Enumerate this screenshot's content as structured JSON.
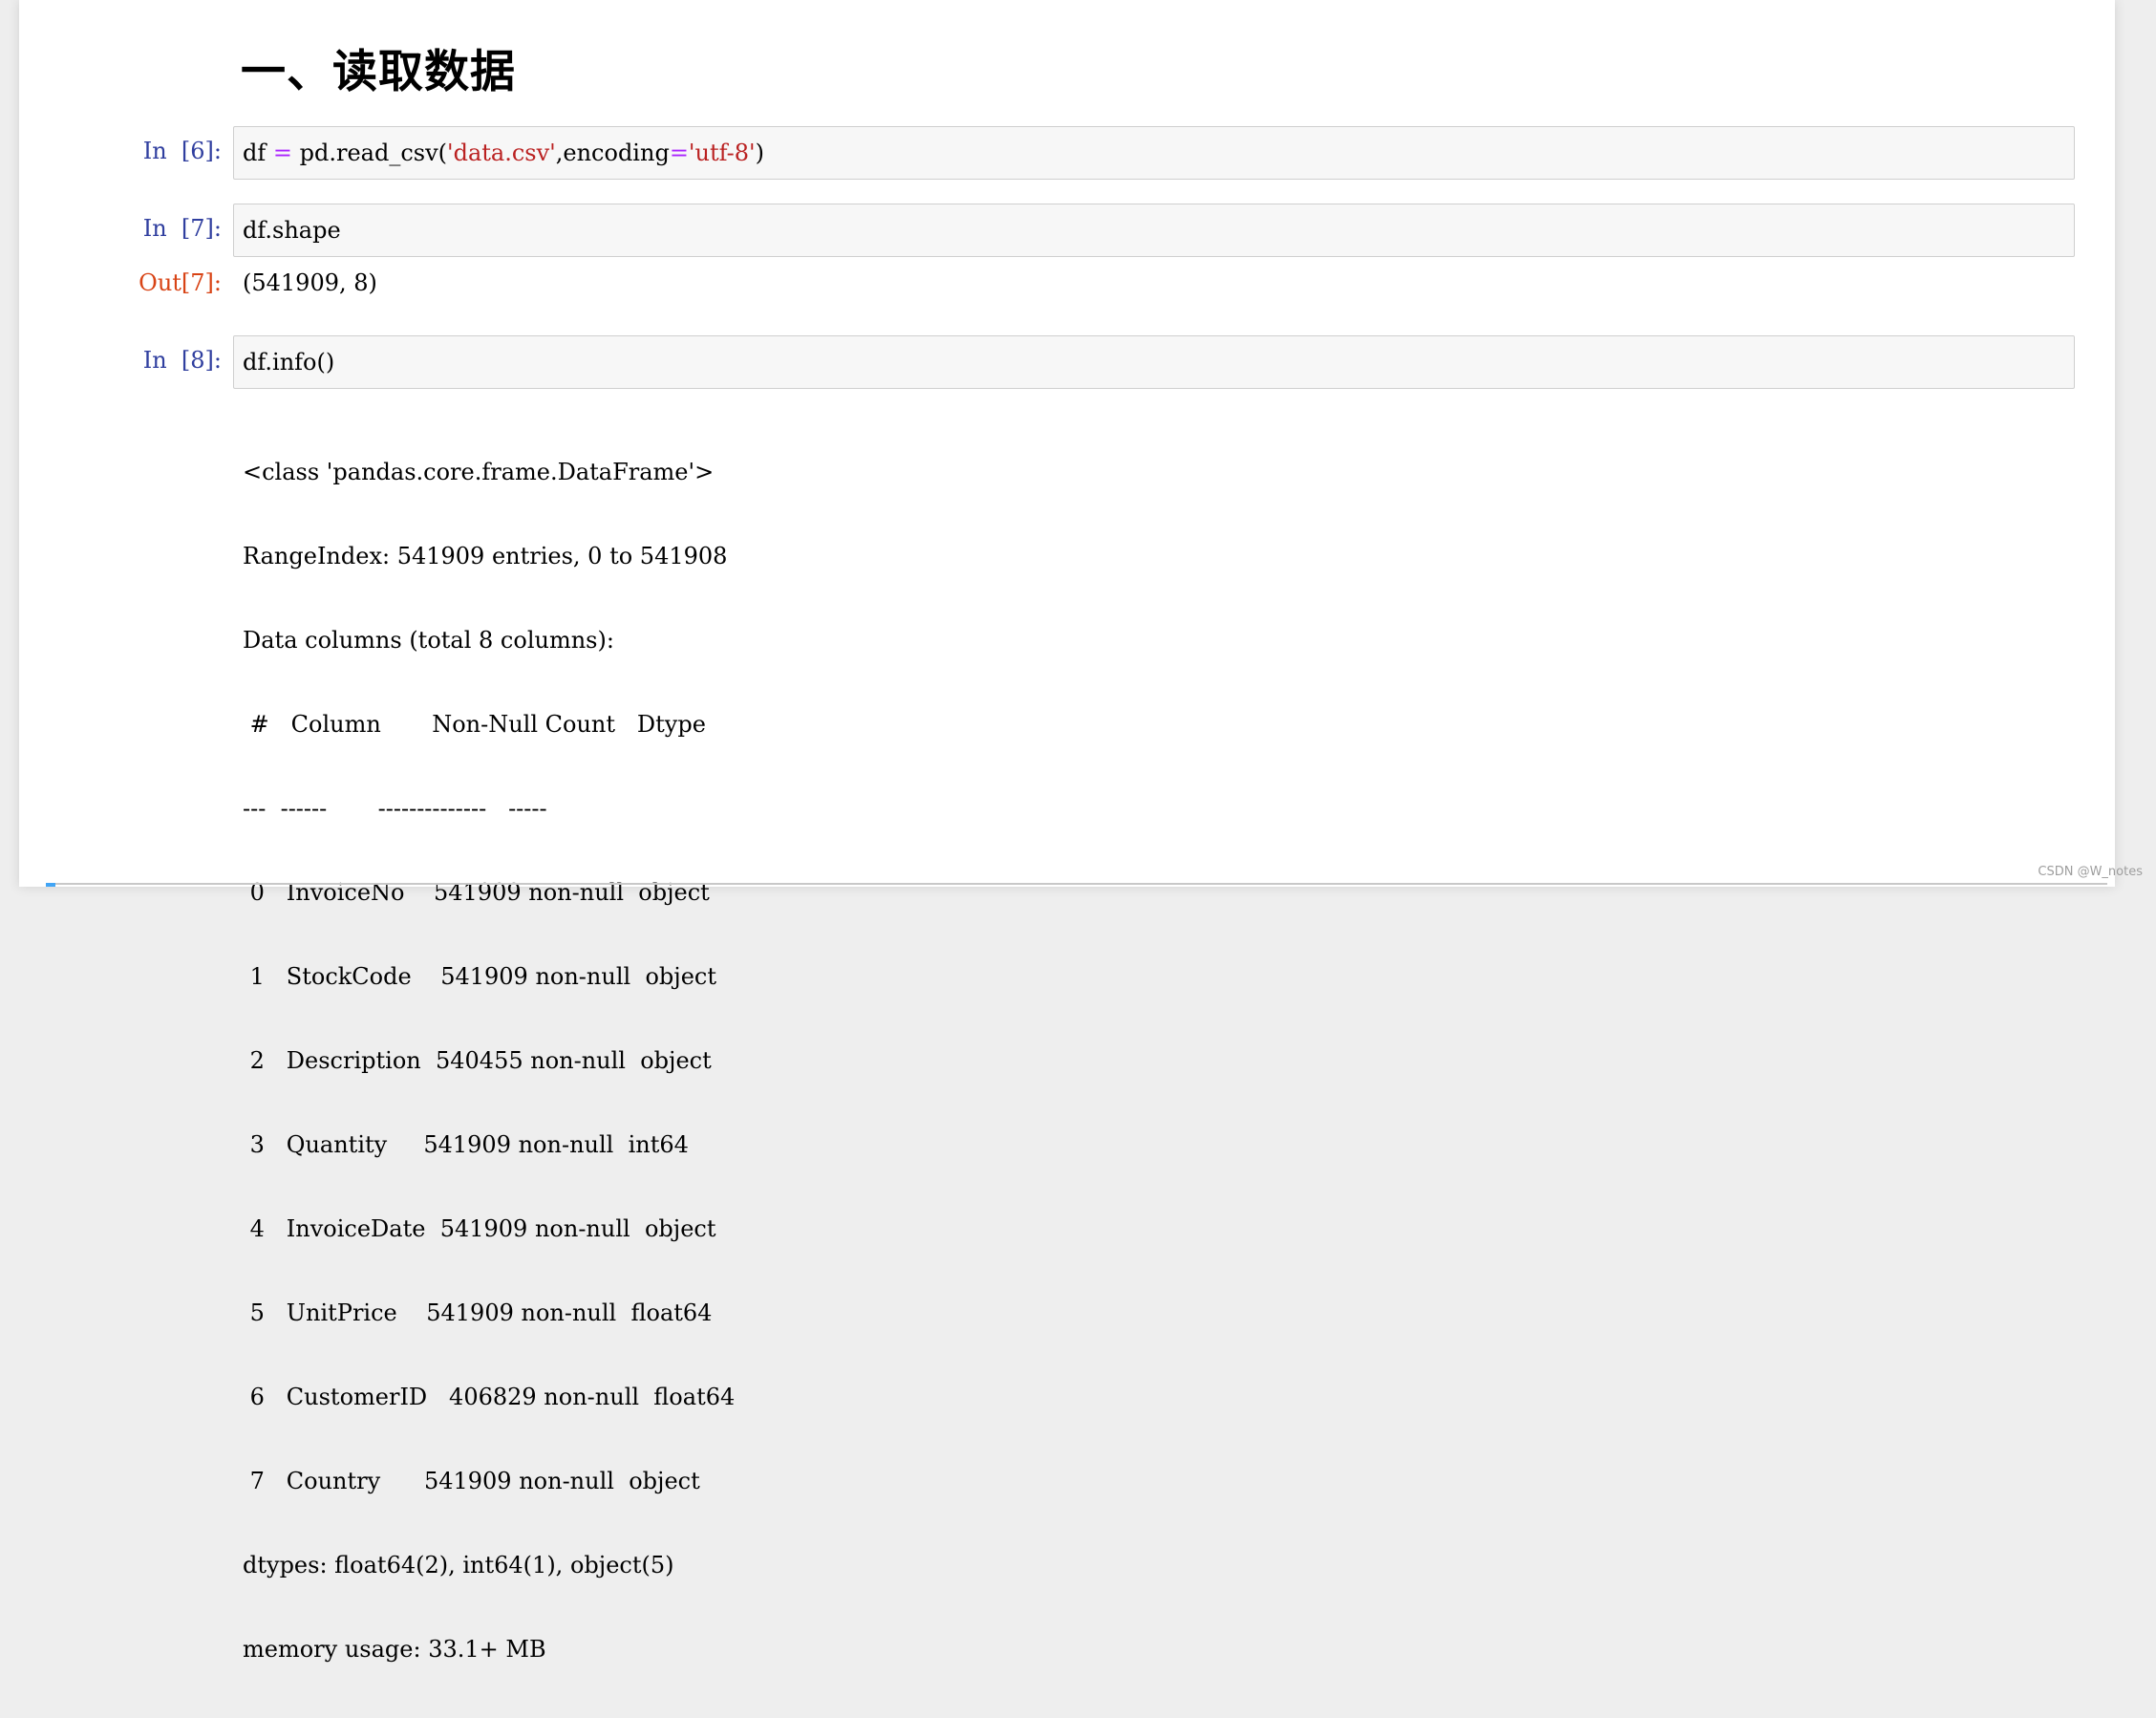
{
  "heading": "一、读取数据",
  "cells": [
    {
      "in_prompt": "In  [6]:",
      "code": {
        "t1": "df ",
        "op1": "=",
        "t2": " pd.read_csv(",
        "s1": "'data.csv'",
        "t3": ",encoding",
        "op2": "=",
        "s2": "'utf-8'",
        "t4": ")"
      }
    },
    {
      "in_prompt": "In  [7]:",
      "code": {
        "t1": "df.shape"
      },
      "out_prompt": "Out[7]:",
      "output": "(541909, 8)"
    },
    {
      "in_prompt": "In  [8]:",
      "code": {
        "t1": "df.info()"
      },
      "output_lines": [
        "<class 'pandas.core.frame.DataFrame'>",
        "RangeIndex: 541909 entries, 0 to 541908",
        "Data columns (total 8 columns):",
        " #   Column       Non-Null Count   Dtype  ",
        "---  ------       --------------   -----  ",
        " 0   InvoiceNo    541909 non-null  object ",
        " 1   StockCode    541909 non-null  object ",
        " 2   Description  540455 non-null  object ",
        " 3   Quantity     541909 non-null  int64  ",
        " 4   InvoiceDate  541909 non-null  object ",
        " 5   UnitPrice    541909 non-null  float64",
        " 6   CustomerID   406829 non-null  float64",
        " 7   Country      541909 non-null  object ",
        "dtypes: float64(2), int64(1), object(5)",
        "memory usage: 33.1+ MB"
      ]
    }
  ],
  "watermark": "CSDN @W_notes"
}
